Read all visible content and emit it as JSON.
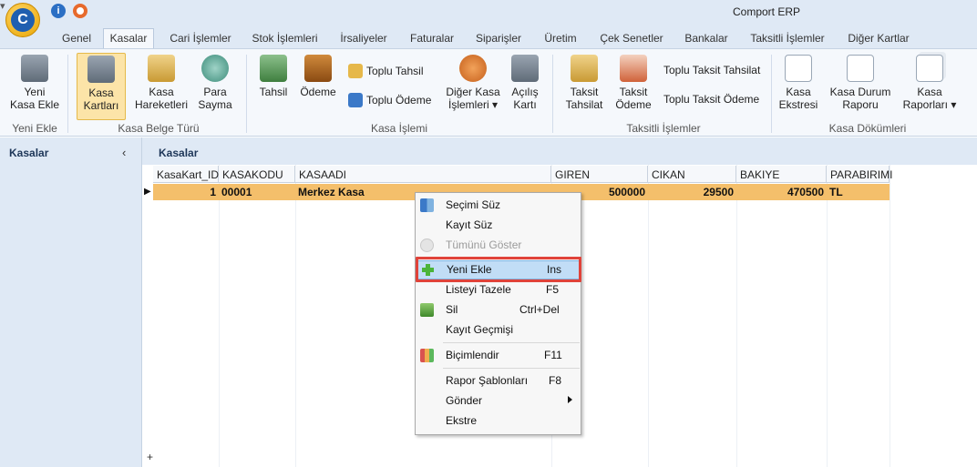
{
  "window": {
    "title": "Comport ERP",
    "logo_letter": "C"
  },
  "tabs": [
    "Genel",
    "Kasalar",
    "Cari İşlemler",
    "Stok İşlemleri",
    "İrsaliyeler",
    "Faturalar",
    "Siparişler",
    "Üretim",
    "Çek Senetler",
    "Bankalar",
    "Taksitli İşlemler",
    "Diğer Kartlar"
  ],
  "ribbon": {
    "yeni_kasa_ekle": "Yeni\nKasa Ekle",
    "kasa_kartlari": "Kasa\nKartları",
    "kasa_hareketleri": "Kasa\nHareketleri",
    "para_sayma": "Para\nSayma",
    "tahsil": "Tahsil",
    "odeme": "Ödeme",
    "toplu_tahsil": "Toplu Tahsil",
    "toplu_odeme": "Toplu Ödeme",
    "diger_kasa_islemleri": "Diğer Kasa\nİşlemleri ▾",
    "acilis_karti": "Açılış\nKartı",
    "taksit_tahsilat": "Taksit\nTahsilat",
    "taksit_odeme": "Taksit\nÖdeme",
    "toplu_taksit_tahsilat": "Toplu Taksit Tahsilat",
    "toplu_taksit_odeme": "Toplu Taksit Ödeme",
    "kasa_ekstresi": "Kasa\nEkstresi",
    "kasa_durum_raporu": "Kasa Durum\nRaporu",
    "kasa_raporlari": "Kasa\nRaporları ▾",
    "groups": {
      "yeni_ekle": "Yeni Ekle",
      "kasa_belge_turu": "Kasa Belge Türü",
      "kasa_islemi": "Kasa İşlemi",
      "taksitli_islemler": "Taksitli İşlemler",
      "kasa_dokumleri": "Kasa Dökümleri"
    }
  },
  "left_panel": {
    "title": "Kasalar",
    "collapse_glyph": "‹"
  },
  "main": {
    "title": "Kasalar"
  },
  "table": {
    "columns": [
      "KasaKart_ID",
      "KASAKODU",
      "KASAADI",
      "GIREN",
      "CIKAN",
      "BAKIYE",
      "PARABIRIMI"
    ],
    "row": {
      "id": "1",
      "kod": "00001",
      "adi": "Merkez Kasa",
      "giren": "500000",
      "cikan": "29500",
      "bakiye": "470500",
      "para": "TL"
    },
    "add_row_glyph": "+"
  },
  "context_menu": {
    "secimi_suz": "Seçimi Süz",
    "kayit_suz": "Kayıt Süz",
    "tumunu_goster": "Tümünü Göster",
    "yeni_ekle": "Yeni Ekle",
    "yeni_ekle_sc": "Ins",
    "listeyi_tazele": "Listeyi Tazele",
    "listeyi_tazele_sc": "F5",
    "sil": "Sil",
    "sil_sc": "Ctrl+Del",
    "kayit_gecmisi": "Kayıt Geçmişi",
    "bicimlendir": "Biçimlendir",
    "bicimlendir_sc": "F11",
    "rapor_sablonlari": "Rapor Şablonları",
    "rapor_sablonlari_sc": "F8",
    "gonder": "Gönder",
    "ekstre": "Ekstre"
  }
}
